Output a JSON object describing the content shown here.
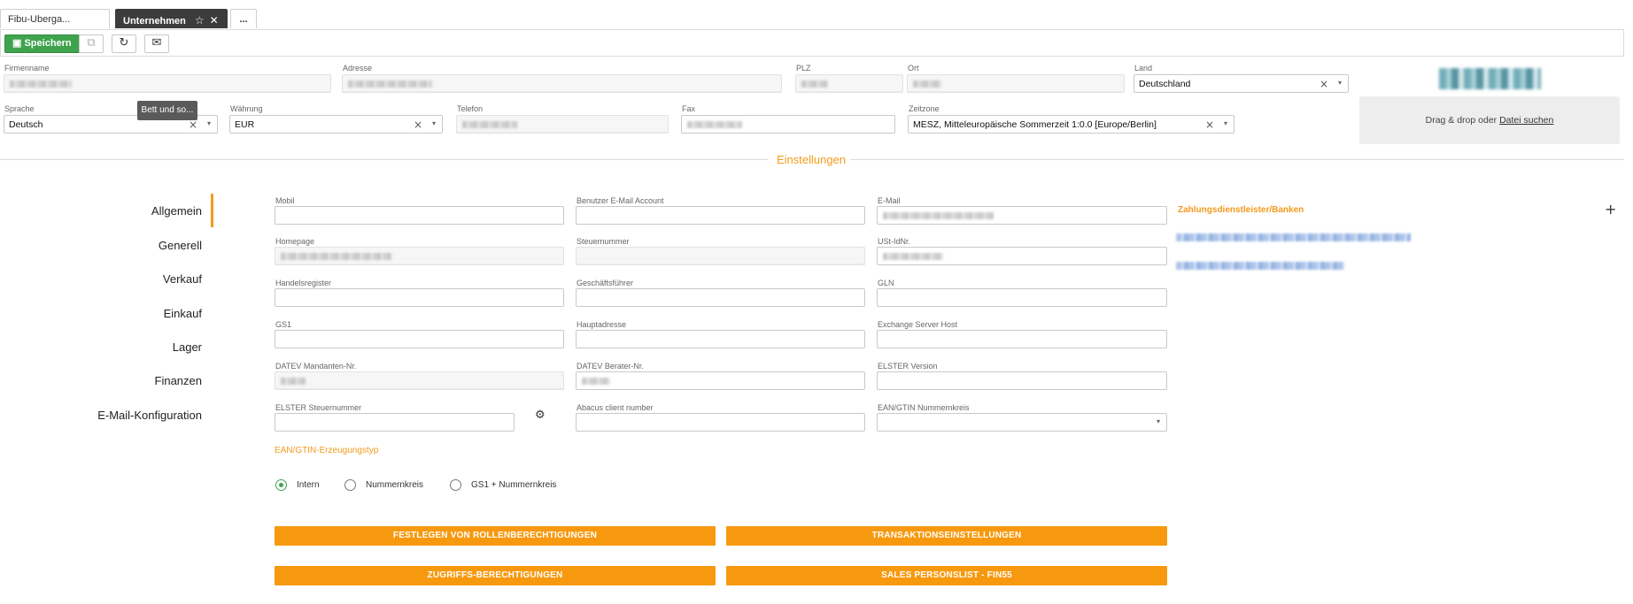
{
  "tabs": [
    {
      "label": "Fibu-Uberga...",
      "active": false
    },
    {
      "label": "Unternehmen",
      "active": true
    }
  ],
  "tab_more_label": "...",
  "toolbar": {
    "save_label": "Speichern",
    "icons": [
      "save-icon",
      "copy-icon",
      "refresh-icon",
      "mail-icon"
    ]
  },
  "company": {
    "firmenname_label": "Firmenname",
    "adresse_label": "Adresse",
    "plz_label": "PLZ",
    "ort_label": "Ort",
    "land_label": "Land",
    "land_value": "Deutschland",
    "sprache_label": "Sprache",
    "sprache_value": "Deutsch",
    "waehrung_label": "Währung",
    "waehrung_value": "EUR",
    "telefon_label": "Telefon",
    "fax_label": "Fax",
    "zeitzone_label": "Zeitzone",
    "zeitzone_value": "MESZ, Mitteleuropäische Sommerzeit 1:0.0 [Europe/Berlin]"
  },
  "tooltip": "Bett und so...",
  "dropzone": {
    "text": "Drag & drop oder ",
    "link": "Datei suchen"
  },
  "section_title": "Einstellungen",
  "nav": {
    "items": [
      "Allgemein",
      "Generell",
      "Verkauf",
      "Einkauf",
      "Lager",
      "Finanzen",
      "E-Mail-Konfiguration"
    ],
    "active": "Allgemein"
  },
  "fields": {
    "mobil": "Mobil",
    "benutzer_email": "Benutzer E-Mail Account",
    "email": "E-Mail",
    "homepage": "Homepage",
    "steuernummer": "Steuernummer",
    "ust_id": "USt-IdNr.",
    "handelsregister": "Handelsregister",
    "geschaeftsfuehrer": "Geschäftsführer",
    "gln": "GLN",
    "gs1": "GS1",
    "hauptadresse": "Hauptadresse",
    "exchange": "Exchange Server Host",
    "datev_mandant": "DATEV Mandanten-Nr.",
    "datev_berater": "DATEV Berater-Nr.",
    "elster_version": "ELSTER Version",
    "elster_steuernummer": "ELSTER Steuernummer",
    "abacus": "Abacus client number",
    "ean_kreis": "EAN/GTIN Nummernkreis"
  },
  "ean_type": {
    "label": "EAN/GTIN-Erzeugungstyp",
    "options": [
      "Intern",
      "Nummernkreis",
      "GS1 + Nummernkreis"
    ],
    "selected": "Intern"
  },
  "buttons": {
    "rollen": "FESTLEGEN VON ROLLENBERECHTIGUNGEN",
    "transaktion": "TRANSAKTIONSEINSTELLUNGEN",
    "zugriffs": "ZUGRIFFS-BERECHTIGUNGEN",
    "sales": "SALES PERSONSLIST - FIN55"
  },
  "banks": {
    "title": "Zahlungsdienstleister/Banken"
  },
  "colors": {
    "accent": "#f39a1d",
    "save": "#3fa34d",
    "dark_tab": "#3c3c3c"
  }
}
